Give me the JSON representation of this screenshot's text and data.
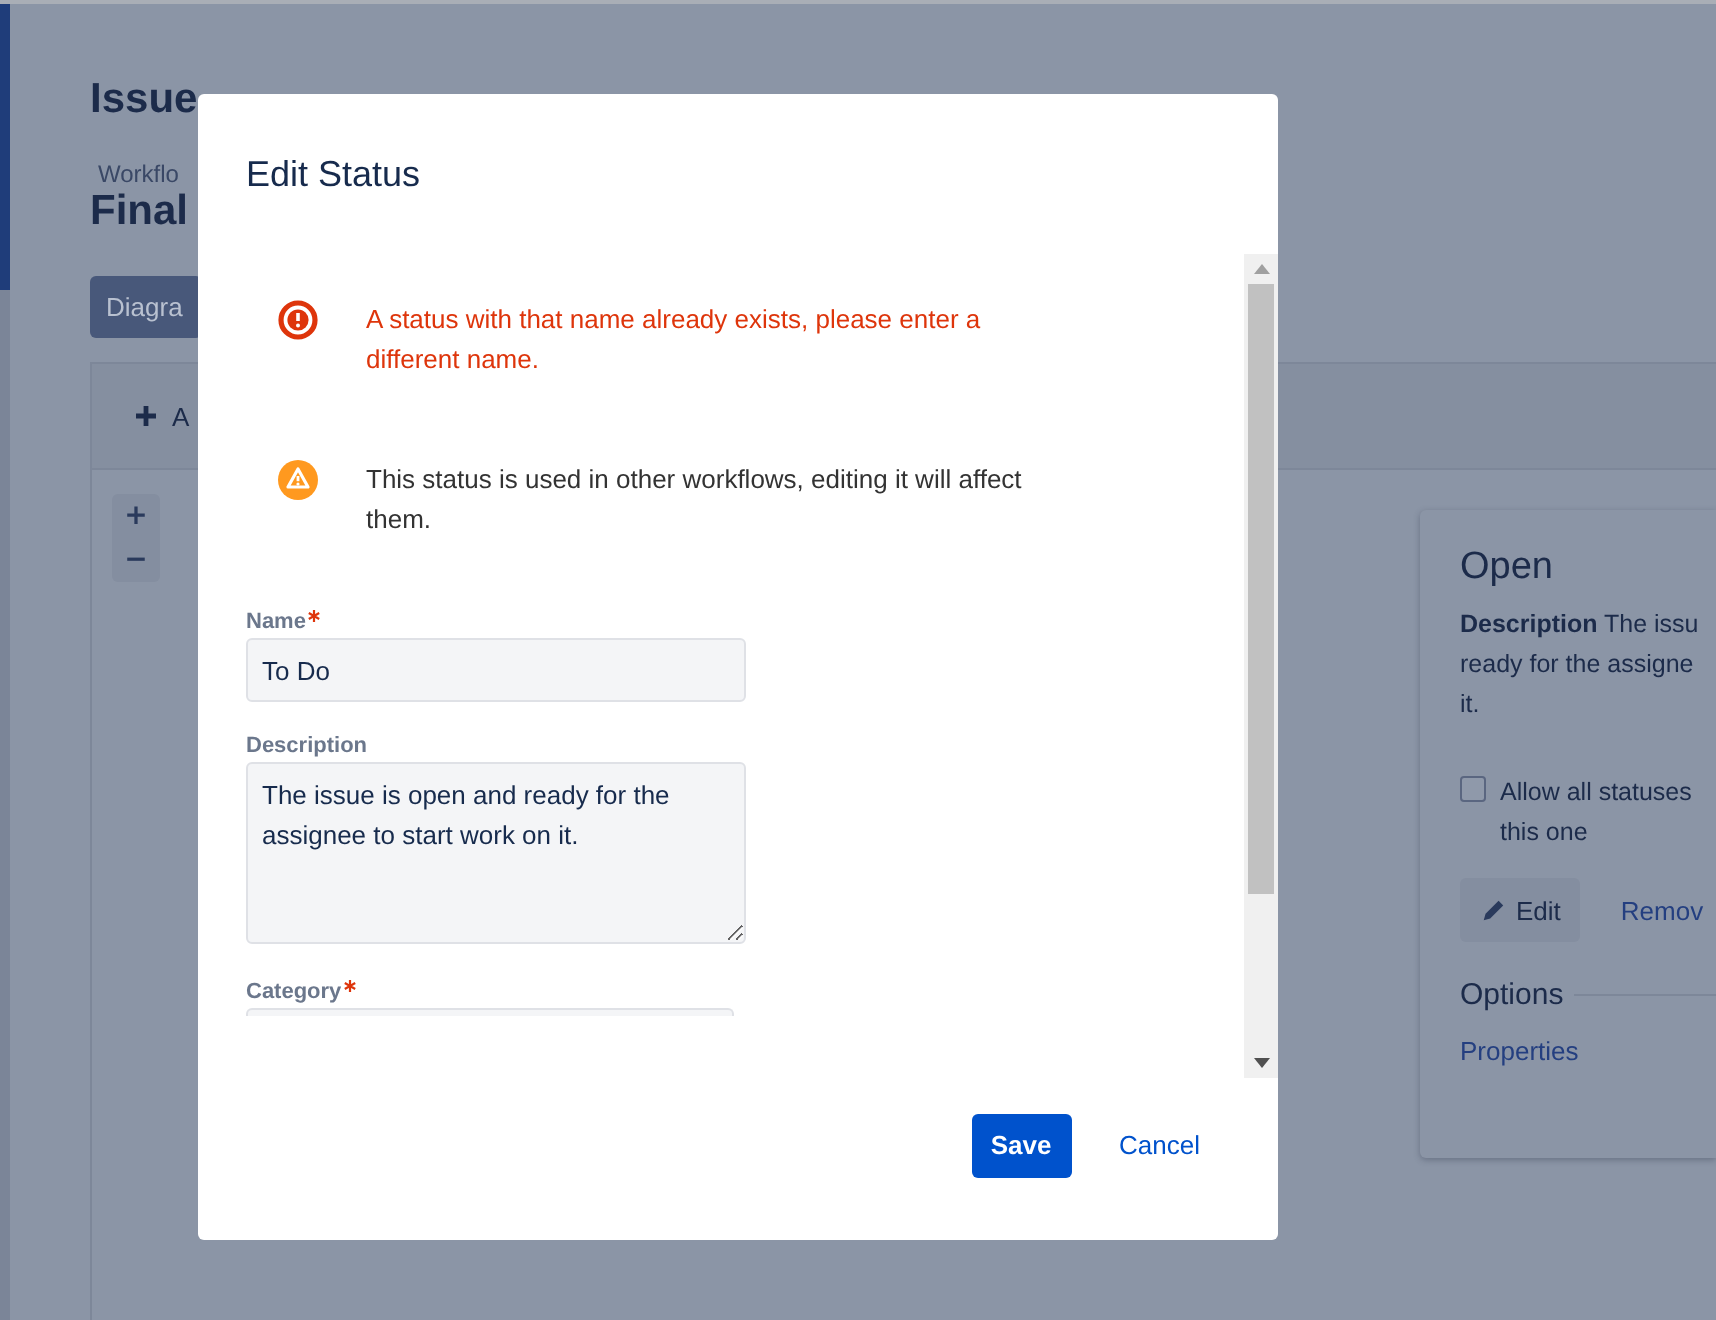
{
  "background": {
    "page_title": "Issue",
    "breadcrumb": "Workflo",
    "workflow_name": "Final",
    "view_button": "Diagra",
    "add_button": "A",
    "zoom_in": "+",
    "zoom_out": "−",
    "status_card": {
      "title": "Open",
      "description_lines": [
        "**Description** The issu",
        "ready for the assigne",
        "it."
      ],
      "checkbox": {
        "label_lines": [
          "Allow all statuses",
          "this one"
        ],
        "checked": false
      },
      "edit_button": "Edit",
      "remove_link": "Remov",
      "options_heading": "Options",
      "properties_link": "Properties"
    }
  },
  "dialog": {
    "title": "Edit Status",
    "messages": [
      {
        "kind": "error",
        "text": "A status with that name already exists, please enter a different name."
      },
      {
        "kind": "warning",
        "text": "This status is used in other workflows, editing it will affect them."
      }
    ],
    "fields": [
      {
        "kind": "text",
        "label": "Name",
        "required": true,
        "value": "To Do"
      },
      {
        "kind": "textarea",
        "label": "Description",
        "required": false,
        "value": "The issue is open and ready for the assignee to start work on it."
      },
      {
        "kind": "select",
        "label": "Category",
        "required": true
      }
    ],
    "buttons": [
      {
        "kind": "primary",
        "label": "Save"
      },
      {
        "kind": "link",
        "label": "Cancel"
      }
    ]
  }
}
